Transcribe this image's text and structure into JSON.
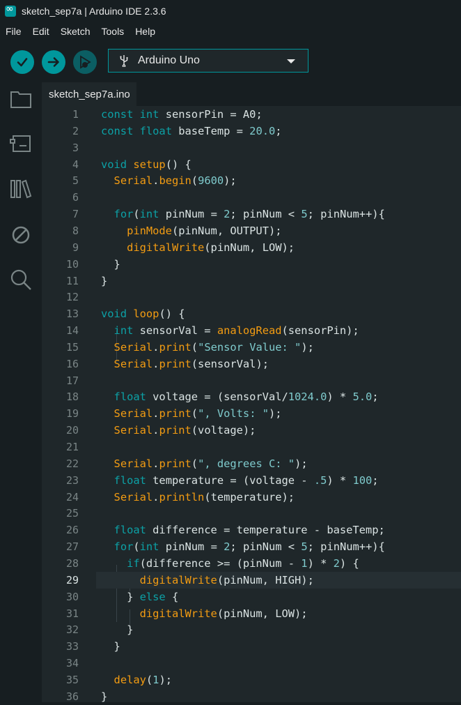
{
  "window": {
    "title": "sketch_sep7a | Arduino IDE 2.3.6"
  },
  "menu": [
    "File",
    "Edit",
    "Sketch",
    "Tools",
    "Help"
  ],
  "toolbar": {
    "verify": "checkmark-icon",
    "upload": "arrow-right-icon",
    "debug": "debug-icon",
    "board": "Arduino Uno"
  },
  "sidebar": [
    "sketchbook-folder-icon",
    "boards-manager-icon",
    "library-manager-icon",
    "debug-disabled-icon",
    "search-icon"
  ],
  "tabs": [
    {
      "label": "sketch_sep7a.ino",
      "active": true
    }
  ],
  "editor": {
    "current_line": 29,
    "lines": [
      {
        "n": "1",
        "t": "const int sensorPin = A0;"
      },
      {
        "n": "2",
        "t": "const float baseTemp = 20.0;"
      },
      {
        "n": "3",
        "t": ""
      },
      {
        "n": "4",
        "t": "void setup() {"
      },
      {
        "n": "5",
        "t": "  Serial.begin(9600);"
      },
      {
        "n": "6",
        "t": ""
      },
      {
        "n": "7",
        "t": "  for(int pinNum = 2; pinNum < 5; pinNum++){"
      },
      {
        "n": "8",
        "t": "    pinMode(pinNum, OUTPUT);"
      },
      {
        "n": "9",
        "t": "    digitalWrite(pinNum, LOW);"
      },
      {
        "n": "10",
        "t": "  }"
      },
      {
        "n": "11",
        "t": "}"
      },
      {
        "n": "12",
        "t": ""
      },
      {
        "n": "13",
        "t": "void loop() {"
      },
      {
        "n": "14",
        "t": "  int sensorVal = analogRead(sensorPin);"
      },
      {
        "n": "15",
        "t": "  Serial.print(\"Sensor Value: \");"
      },
      {
        "n": "16",
        "t": "  Serial.print(sensorVal);"
      },
      {
        "n": "17",
        "t": ""
      },
      {
        "n": "18",
        "t": "  float voltage = (sensorVal/1024.0) * 5.0;"
      },
      {
        "n": "19",
        "t": "  Serial.print(\", Volts: \");"
      },
      {
        "n": "20",
        "t": "  Serial.print(voltage);"
      },
      {
        "n": "21",
        "t": ""
      },
      {
        "n": "22",
        "t": "  Serial.print(\", degrees C: \");"
      },
      {
        "n": "23",
        "t": "  float temperature = (voltage - .5) * 100;"
      },
      {
        "n": "24",
        "t": "  Serial.println(temperature);"
      },
      {
        "n": "25",
        "t": ""
      },
      {
        "n": "26",
        "t": "  float difference = temperature - baseTemp;"
      },
      {
        "n": "27",
        "t": "  for(int pinNum = 2; pinNum < 5; pinNum++){"
      },
      {
        "n": "28",
        "t": "    if(difference >= (pinNum - 1) * 2) {"
      },
      {
        "n": "29",
        "t": "      digitalWrite(pinNum, HIGH);"
      },
      {
        "n": "30",
        "t": "    } else {"
      },
      {
        "n": "31",
        "t": "      digitalWrite(pinNum, LOW);"
      },
      {
        "n": "32",
        "t": "    }"
      },
      {
        "n": "33",
        "t": "  }"
      },
      {
        "n": "34",
        "t": ""
      },
      {
        "n": "35",
        "t": "  delay(1);"
      },
      {
        "n": "36",
        "t": "}"
      }
    ]
  },
  "colors": {
    "accent": "#00979c",
    "keyword": "#0ca1a6",
    "function": "#f39c12",
    "literal": "#7fcbcd",
    "text": "#dae3e3",
    "background": "#1f272a"
  }
}
